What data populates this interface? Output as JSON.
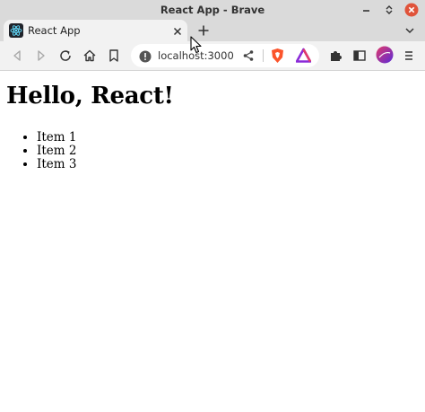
{
  "window": {
    "title": "React App - Brave"
  },
  "tab": {
    "title": "React App"
  },
  "address_bar": {
    "url": "localhost:3000"
  },
  "page": {
    "heading": "Hello, React!",
    "items": [
      "Item 1",
      "Item 2",
      "Item 3"
    ]
  },
  "icons": {
    "titlebar": [
      "minimize-icon",
      "maximize-icon",
      "close-icon"
    ],
    "toolbar": [
      "back-icon",
      "forward-icon",
      "reload-icon",
      "home-icon",
      "bookmark-icon",
      "info-icon",
      "share-icon",
      "brave-shields-icon",
      "brave-rewards-icon",
      "extensions-icon",
      "sidebar-icon",
      "profile-avatar",
      "menu-icon"
    ]
  },
  "colors": {
    "window_close": "#e0533a",
    "brave_orange": "#fb542b",
    "react_blue": "#61dafb"
  }
}
